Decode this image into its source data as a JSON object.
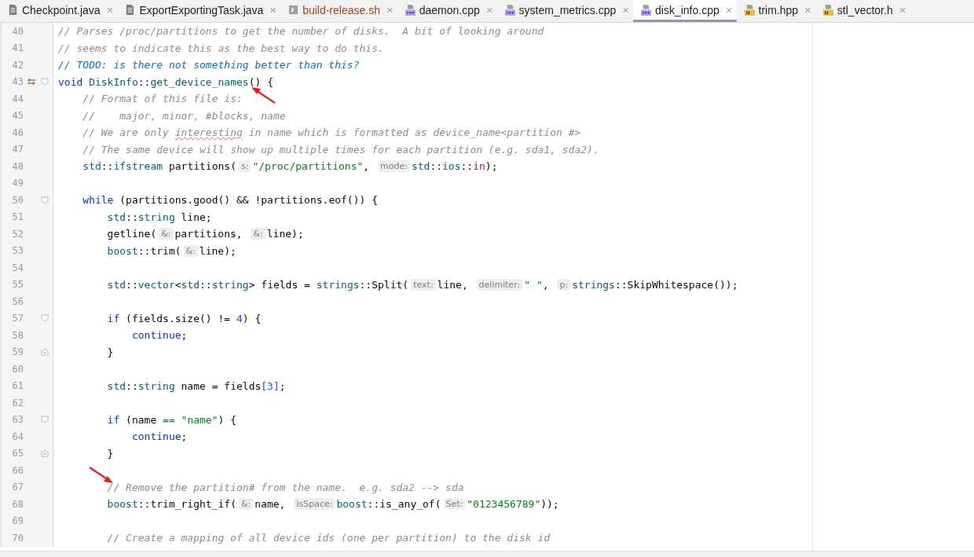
{
  "tabs": [
    {
      "label": "Checkpoint.java",
      "kind": "file",
      "color": "#1f1f1f",
      "selected": false
    },
    {
      "label": "ExportExportingTask.java",
      "kind": "file",
      "color": "#1f1f1f",
      "selected": false
    },
    {
      "label": "build-release.sh",
      "kind": "shell",
      "color": "#a3431d",
      "selected": false
    },
    {
      "label": "daemon.cpp",
      "kind": "cpp",
      "color": "#1f1f1f",
      "selected": false
    },
    {
      "label": "system_metrics.cpp",
      "kind": "cpp",
      "color": "#1f1f1f",
      "selected": false
    },
    {
      "label": "disk_info.cpp",
      "kind": "cpp",
      "color": "#1f1f1f",
      "selected": true
    },
    {
      "label": "trim.hpp",
      "kind": "header",
      "color": "#1f1f1f",
      "selected": false
    },
    {
      "label": "stl_vector.h",
      "kind": "header",
      "color": "#1f1f1f",
      "selected": false
    }
  ],
  "tab_close": "×",
  "lines": [
    {
      "number": "40",
      "tokens": [
        {
          "kind": "comment",
          "text": "// Parses /proc/partitions to get the number of disks.  A bit of looking around"
        }
      ]
    },
    {
      "number": "41",
      "tokens": [
        {
          "kind": "comment",
          "text": "// seems to indicate this as the best way to do this."
        }
      ]
    },
    {
      "number": "42",
      "tokens": [
        {
          "kind": "todo",
          "text": "// TODO: is there not something better than this?"
        }
      ]
    },
    {
      "number": "43",
      "fold_start": true,
      "change": true,
      "annotation": {
        "kind": "up-left-arrow"
      },
      "tokens": [
        {
          "kind": "keyword",
          "text": "void "
        },
        {
          "kind": "type",
          "text": "DiskInfo"
        },
        {
          "kind": "plain",
          "text": "::"
        },
        {
          "kind": "type",
          "text": "get_device_names"
        },
        {
          "kind": "plain",
          "text": "() {"
        }
      ]
    },
    {
      "number": "44",
      "tokens": [
        {
          "kind": "comment",
          "text": "    // Format of this file is:"
        }
      ]
    },
    {
      "number": "45",
      "tokens": [
        {
          "kind": "comment",
          "text": "    //    major, minor, #blocks, name"
        }
      ]
    },
    {
      "number": "46",
      "tokens": [
        {
          "kind": "comment",
          "text": "    // We are only "
        },
        {
          "kind": "typo",
          "text": "interesting"
        },
        {
          "kind": "comment",
          "text": " in name which is formatted as device_name<partition #>"
        }
      ]
    },
    {
      "number": "47",
      "tokens": [
        {
          "kind": "comment",
          "text": "    // The same device will show up multiple times for each partition (e.g. sda1, sda2)."
        }
      ]
    },
    {
      "number": "48",
      "tokens": [
        {
          "kind": "type",
          "text": "    std"
        },
        {
          "kind": "plain",
          "text": "::"
        },
        {
          "kind": "type",
          "text": "ifstream"
        },
        {
          "kind": "plain",
          "text": " partitions("
        },
        {
          "kind": "hint",
          "text": "s:"
        },
        {
          "kind": "string",
          "text": "\"/proc/partitions\""
        },
        {
          "kind": "plain",
          "text": ", "
        },
        {
          "kind": "hint",
          "text": "mode:"
        },
        {
          "kind": "type",
          "text": "std"
        },
        {
          "kind": "plain",
          "text": "::"
        },
        {
          "kind": "type",
          "text": "ios"
        },
        {
          "kind": "plain",
          "text": "::"
        },
        {
          "kind": "member",
          "text": "in"
        },
        {
          "kind": "plain",
          "text": ");"
        }
      ]
    },
    {
      "number": "49"
    },
    {
      "number": "50",
      "fold_start": true,
      "tokens": [
        {
          "kind": "keyword",
          "text": "    while"
        },
        {
          "kind": "plain",
          "text": " (partitions.good() && !partitions.eof()) {"
        }
      ]
    },
    {
      "number": "51",
      "tokens": [
        {
          "kind": "type",
          "text": "        std"
        },
        {
          "kind": "plain",
          "text": "::"
        },
        {
          "kind": "type",
          "text": "string"
        },
        {
          "kind": "plain",
          "text": " line;"
        }
      ]
    },
    {
      "number": "52",
      "tokens": [
        {
          "kind": "plain",
          "text": "        getline("
        },
        {
          "kind": "hint",
          "text": "&:"
        },
        {
          "kind": "plain",
          "text": "partitions, "
        },
        {
          "kind": "hint",
          "text": "&:"
        },
        {
          "kind": "plain",
          "text": "line);"
        }
      ]
    },
    {
      "number": "53",
      "tokens": [
        {
          "kind": "type",
          "text": "        boost"
        },
        {
          "kind": "plain",
          "text": "::trim("
        },
        {
          "kind": "hint",
          "text": "&:"
        },
        {
          "kind": "plain",
          "text": "line);"
        }
      ]
    },
    {
      "number": "54"
    },
    {
      "number": "55",
      "tokens": [
        {
          "kind": "type",
          "text": "        std"
        },
        {
          "kind": "plain",
          "text": "::"
        },
        {
          "kind": "type",
          "text": "vector"
        },
        {
          "kind": "plain",
          "text": "<"
        },
        {
          "kind": "type",
          "text": "std"
        },
        {
          "kind": "plain",
          "text": "::"
        },
        {
          "kind": "type",
          "text": "string"
        },
        {
          "kind": "plain",
          "text": "> fields = "
        },
        {
          "kind": "type",
          "text": "strings"
        },
        {
          "kind": "plain",
          "text": "::Split("
        },
        {
          "kind": "hint",
          "text": "text:"
        },
        {
          "kind": "plain",
          "text": "line, "
        },
        {
          "kind": "hint",
          "text": "delimiter:"
        },
        {
          "kind": "string",
          "text": "\" \""
        },
        {
          "kind": "plain",
          "text": ", "
        },
        {
          "kind": "hint",
          "text": "p:"
        },
        {
          "kind": "type",
          "text": "strings"
        },
        {
          "kind": "plain",
          "text": "::SkipWhitespace());"
        }
      ]
    },
    {
      "number": "56"
    },
    {
      "number": "57",
      "fold_start": true,
      "tokens": [
        {
          "kind": "keyword",
          "text": "        if"
        },
        {
          "kind": "plain",
          "text": " (fields.size() != "
        },
        {
          "kind": "number",
          "text": "4"
        },
        {
          "kind": "plain",
          "text": ") {"
        }
      ]
    },
    {
      "number": "58",
      "tokens": [
        {
          "kind": "keyword",
          "text": "            continue"
        },
        {
          "kind": "plain",
          "text": ";"
        }
      ]
    },
    {
      "number": "59",
      "fold_end": true,
      "tokens": [
        {
          "kind": "plain",
          "text": "        }"
        }
      ]
    },
    {
      "number": "60"
    },
    {
      "number": "61",
      "tokens": [
        {
          "kind": "type",
          "text": "        std"
        },
        {
          "kind": "plain",
          "text": "::"
        },
        {
          "kind": "type",
          "text": "string"
        },
        {
          "kind": "plain",
          "text": " name = fields"
        },
        {
          "kind": "number",
          "text": "[3]"
        },
        {
          "kind": "plain",
          "text": ";"
        }
      ]
    },
    {
      "number": "62"
    },
    {
      "number": "63",
      "fold_start": true,
      "tokens": [
        {
          "kind": "keyword",
          "text": "        if"
        },
        {
          "kind": "plain",
          "text": " (name "
        },
        {
          "kind": "type",
          "text": "=="
        },
        {
          "kind": "string",
          "text": " \"name\""
        },
        {
          "kind": "plain",
          "text": ") {"
        }
      ]
    },
    {
      "number": "64",
      "tokens": [
        {
          "kind": "keyword",
          "text": "            continue"
        },
        {
          "kind": "plain",
          "text": ";"
        }
      ]
    },
    {
      "number": "65",
      "fold_end": true,
      "tokens": [
        {
          "kind": "plain",
          "text": "        }"
        }
      ]
    },
    {
      "number": "66",
      "annotation": {
        "kind": "down-right-arrow"
      }
    },
    {
      "number": "67",
      "tokens": [
        {
          "kind": "comment",
          "text": "        // Remove the partition# from the name.  e.g. sda2 --> sda"
        }
      ]
    },
    {
      "number": "68",
      "tokens": [
        {
          "kind": "type",
          "text": "        boost"
        },
        {
          "kind": "plain",
          "text": "::trim_right_if("
        },
        {
          "kind": "hint",
          "text": "&:"
        },
        {
          "kind": "plain",
          "text": "name, "
        },
        {
          "kind": "hint",
          "text": "IsSpace:"
        },
        {
          "kind": "type",
          "text": "boost"
        },
        {
          "kind": "plain",
          "text": "::is_any_of("
        },
        {
          "kind": "hint",
          "text": "Set:"
        },
        {
          "kind": "string",
          "text": "\"0123456789\""
        },
        {
          "kind": "plain",
          "text": "));"
        }
      ]
    },
    {
      "number": "69"
    },
    {
      "number": "70",
      "tokens": [
        {
          "kind": "comment",
          "text": "        // Create a mapping of all device ids (one per partition) to the disk id"
        }
      ]
    }
  ]
}
